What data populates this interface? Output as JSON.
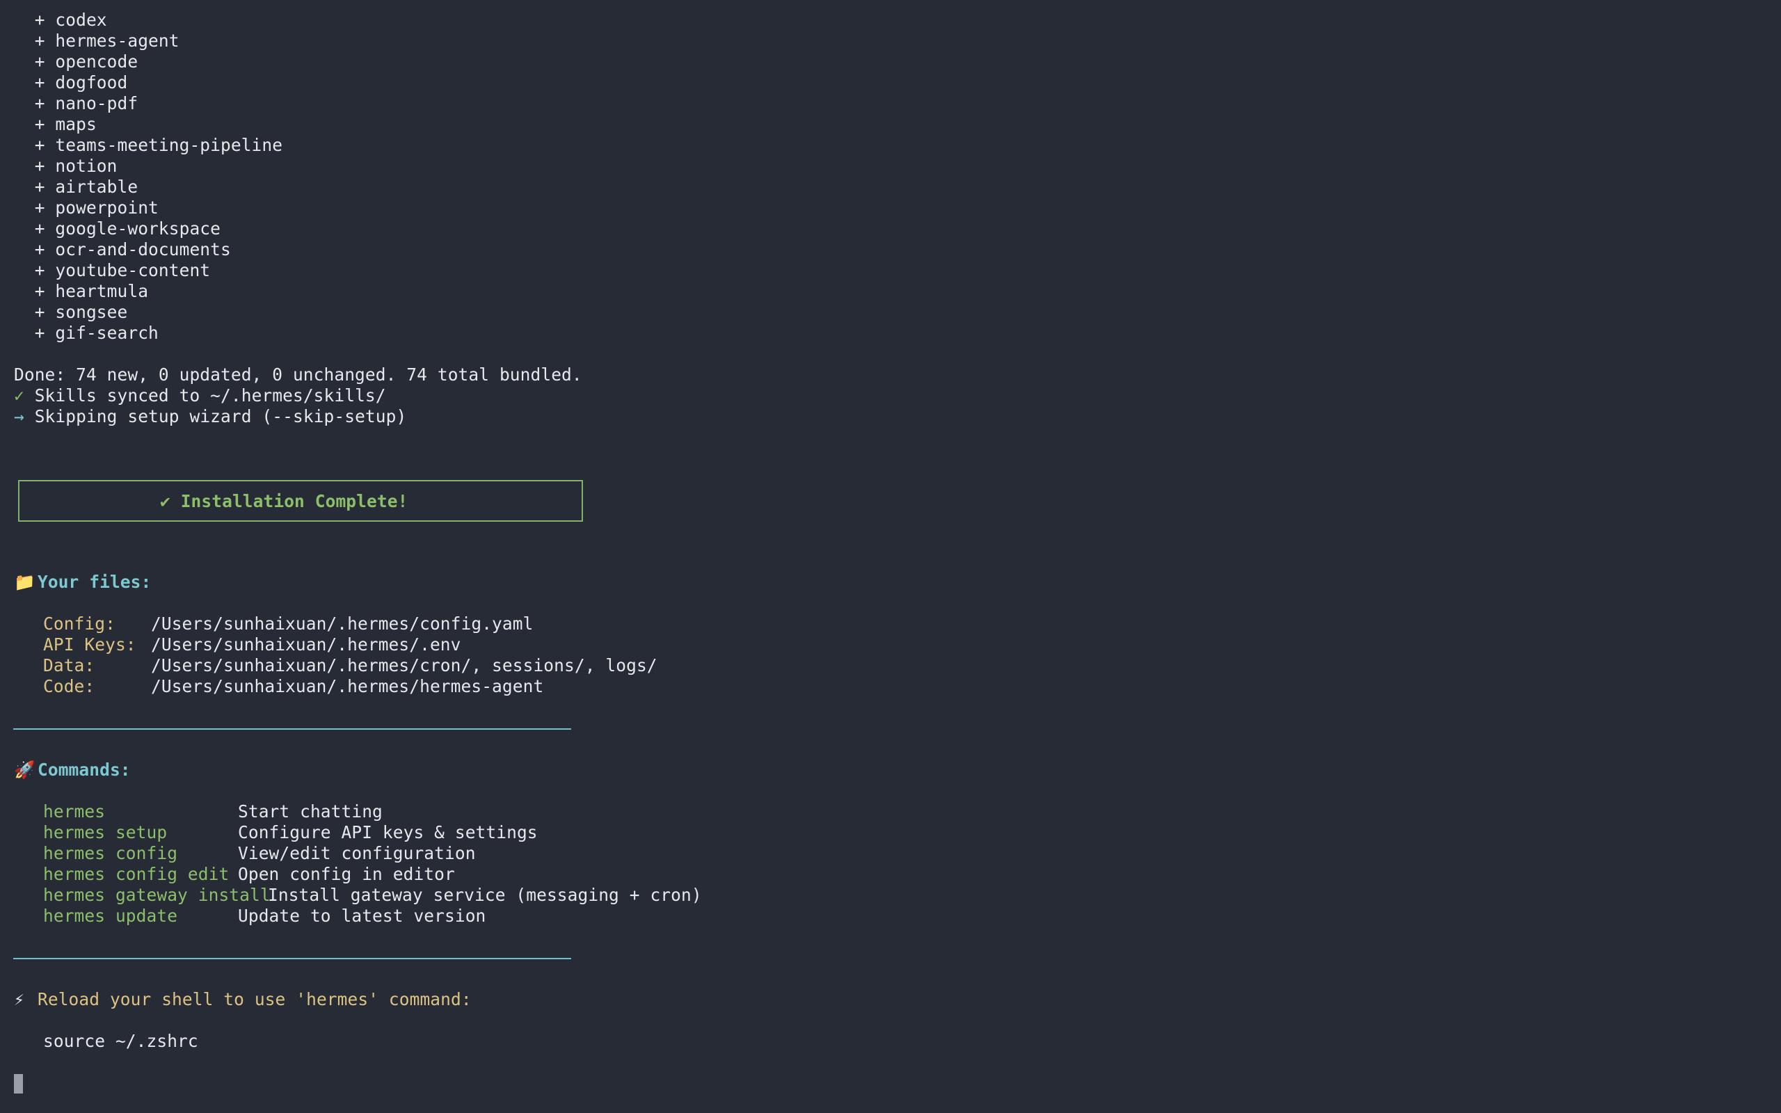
{
  "skills_list": [
    "codex",
    "hermes-agent",
    "opencode",
    "dogfood",
    "nano-pdf",
    "maps",
    "teams-meeting-pipeline",
    "notion",
    "airtable",
    "powerpoint",
    "google-workspace",
    "ocr-and-documents",
    "youtube-content",
    "heartmula",
    "songsee",
    "gif-search"
  ],
  "list_prefix": "  + ",
  "summary": {
    "done_line": "Done: 74 new, 0 updated, 0 unchanged. 74 total bundled.",
    "synced_mark": "✓",
    "synced_text": " Skills synced to ~/.hermes/skills/",
    "skip_mark": "→",
    "skip_text": " Skipping setup wizard (--skip-setup)"
  },
  "banner": {
    "text": "✔ Installation Complete!"
  },
  "files": {
    "icon": "📁",
    "heading": "Your files:",
    "rows": [
      {
        "label": "Config:",
        "value": "/Users/sunhaixuan/.hermes/config.yaml"
      },
      {
        "label": "API Keys:",
        "value": "/Users/sunhaixuan/.hermes/.env"
      },
      {
        "label": "Data:",
        "value": "/Users/sunhaixuan/.hermes/cron/, sessions/, logs/"
      },
      {
        "label": "Code:",
        "value": "/Users/sunhaixuan/.hermes/hermes-agent"
      }
    ]
  },
  "commands": {
    "icon": "🚀",
    "heading": "Commands:",
    "rows": [
      {
        "cmd": "hermes",
        "desc": "Start chatting"
      },
      {
        "cmd": "hermes setup",
        "desc": "Configure API keys & settings"
      },
      {
        "cmd": "hermes config",
        "desc": "View/edit configuration"
      },
      {
        "cmd": "hermes config edit",
        "desc": "Open config in editor"
      },
      {
        "cmd": "hermes gateway install",
        "desc": "Install gateway service (messaging + cron)"
      },
      {
        "cmd": "hermes update",
        "desc": "Update to latest version"
      }
    ]
  },
  "reload": {
    "icon": "⚡",
    "text": "Reload your shell to use 'hermes' command:",
    "command": "source ~/.zshrc"
  },
  "colors": {
    "background": "#272b36",
    "foreground": "#e6e8ec",
    "green": "#8cbf6a",
    "gold": "#dcc383",
    "cyan": "#7dc9d1"
  }
}
